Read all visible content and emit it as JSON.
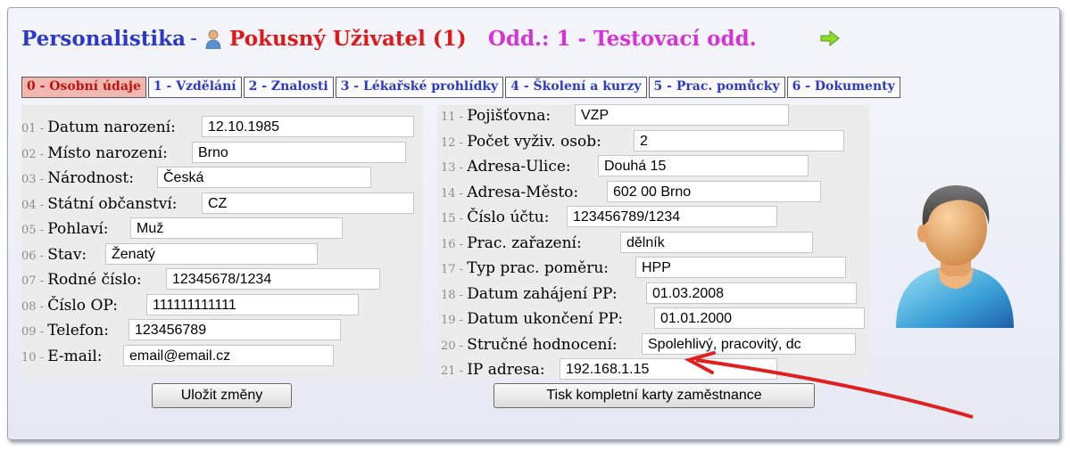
{
  "header": {
    "app_title": "Personalistika",
    "dash": "-",
    "user_name": "Pokusný Uživatel (1)",
    "department": "Odd.: 1 - Testovací odd."
  },
  "tabs": [
    {
      "label": "0 - Osobní údaje",
      "active": true
    },
    {
      "label": "1 - Vzdělání",
      "active": false
    },
    {
      "label": "2 - Znalosti",
      "active": false
    },
    {
      "label": "3 - Lékařské prohlídky",
      "active": false
    },
    {
      "label": "4 - Školení a kurzy",
      "active": false
    },
    {
      "label": "5 - Prac. pomůcky",
      "active": false
    },
    {
      "label": "6 - Dokumenty",
      "active": false
    }
  ],
  "left_fields": [
    {
      "num": "01 - ",
      "label": "Datum narození:",
      "value": "12.10.1985"
    },
    {
      "num": "02 - ",
      "label": "Místo narození:",
      "value": "Brno"
    },
    {
      "num": "03 - ",
      "label": "Národnost:",
      "value": "Česká"
    },
    {
      "num": "04 - ",
      "label": "Státní občanství:",
      "value": "CZ"
    },
    {
      "num": "05 - ",
      "label": "Pohlaví:",
      "value": "Muž"
    },
    {
      "num": "06 - ",
      "label": "Stav:",
      "value": "Ženatý"
    },
    {
      "num": "07 - ",
      "label": "Rodné číslo:",
      "value": "12345678/1234"
    },
    {
      "num": "08 - ",
      "label": "Číslo OP:",
      "value": "111111111111"
    },
    {
      "num": "09 - ",
      "label": "Telefon:",
      "value": "123456789"
    },
    {
      "num": "10 - ",
      "label": "E-mail:",
      "value": "email@email.cz"
    }
  ],
  "right_fields": [
    {
      "num": "11 - ",
      "label": "Pojišťovna:",
      "value": "VZP"
    },
    {
      "num": "12 - ",
      "label": "Počet vyživ. osob:",
      "value": "2"
    },
    {
      "num": "13 - ",
      "label": "Adresa-Ulice:",
      "value": "Douhá 15"
    },
    {
      "num": "14 - ",
      "label": "Adresa-Město:",
      "value": "602 00 Brno"
    },
    {
      "num": "15 - ",
      "label": "Číslo účtu:",
      "value": "123456789/1234"
    },
    {
      "num": "16 - ",
      "label": "Prac. zařazení:",
      "value": "dělník"
    },
    {
      "num": "17 - ",
      "label": "Typ prac. poměru:",
      "value": "HPP"
    },
    {
      "num": "18 - ",
      "label": "Datum zahájení PP:",
      "value": "01.03.2008"
    },
    {
      "num": "19 - ",
      "label": "Datum ukončení PP:",
      "value": "01.01.2000"
    },
    {
      "num": "20 - ",
      "label": "Stručné hodnocení:",
      "value": "Spolehlivý, pracovitý, dc"
    },
    {
      "num": "21 - ",
      "label": "IP adresa:",
      "value": "192.168.1.15"
    }
  ],
  "buttons": {
    "save": "Uložit změny",
    "print": "Tisk kompletní karty zaměstnance"
  },
  "icons": {
    "mini_user": "user-icon",
    "next_arrow": "green-arrow-icon",
    "avatar": "person-avatar-icon",
    "annotation": "red-arrow-annotation"
  },
  "colors": {
    "title_blue": "#2b39c8",
    "user_red": "#e01818",
    "dept_pink": "#d633d6",
    "active_tab_bg": "#f0b8b0"
  }
}
